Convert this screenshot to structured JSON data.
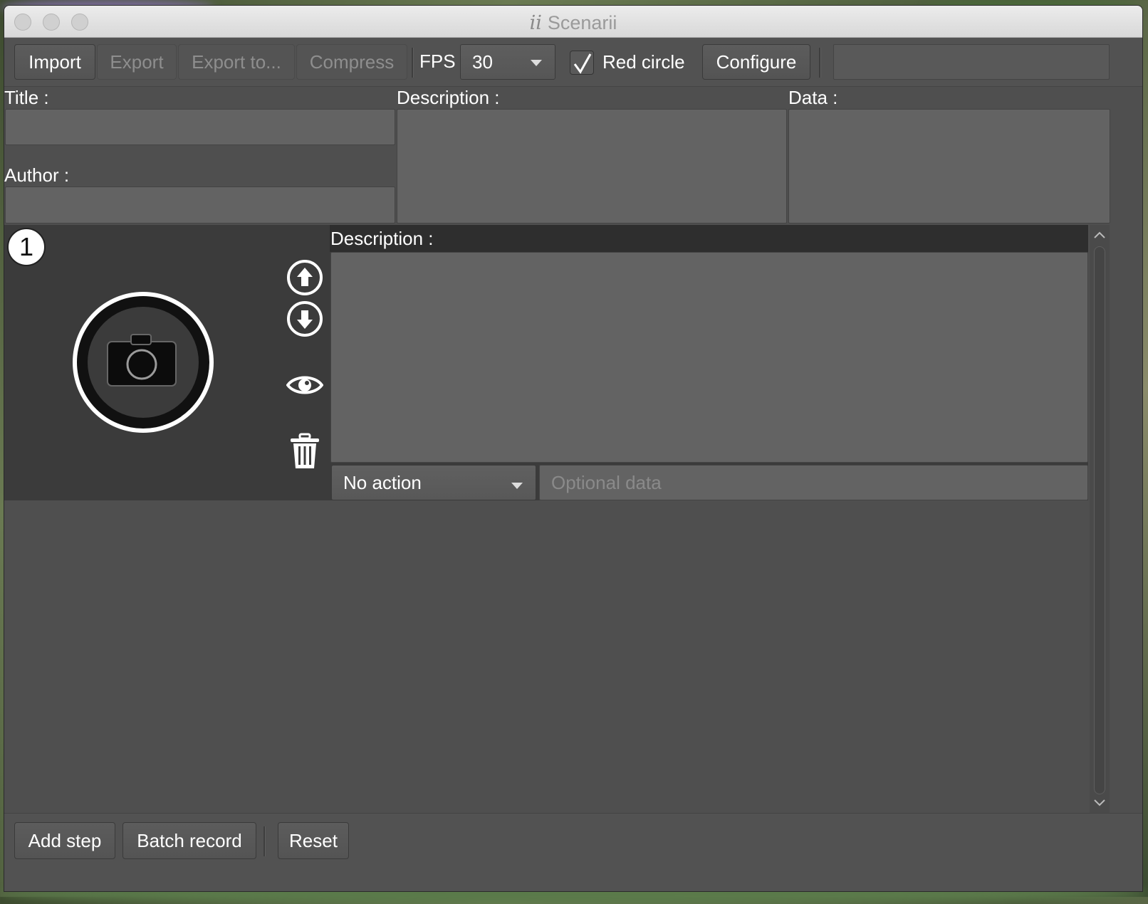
{
  "window": {
    "title": "Scenarii",
    "logo_text": "ii"
  },
  "toolbar": {
    "import_label": "Import",
    "export_label": "Export",
    "export_to_label": "Export to...",
    "compress_label": "Compress",
    "fps_label": "FPS",
    "fps_value": "30",
    "red_circle_checked": true,
    "red_circle_label": "Red circle",
    "configure_label": "Configure",
    "search_value": ""
  },
  "metadata": {
    "title_label": "Title :",
    "title_value": "",
    "author_label": "Author :",
    "author_value": "",
    "description_label": "Description :",
    "description_value": "",
    "data_label": "Data :",
    "data_value": ""
  },
  "steps": [
    {
      "number": "1",
      "description_label": "Description :",
      "description_value": "",
      "action_value": "No action",
      "optional_data_placeholder": "Optional data"
    }
  ],
  "bottom": {
    "add_step_label": "Add step",
    "batch_record_label": "Batch record",
    "reset_label": "Reset"
  },
  "colors": {
    "window_bg": "#4f4f4f",
    "step_bg": "#3b3b3b",
    "field_bg": "#636363"
  }
}
